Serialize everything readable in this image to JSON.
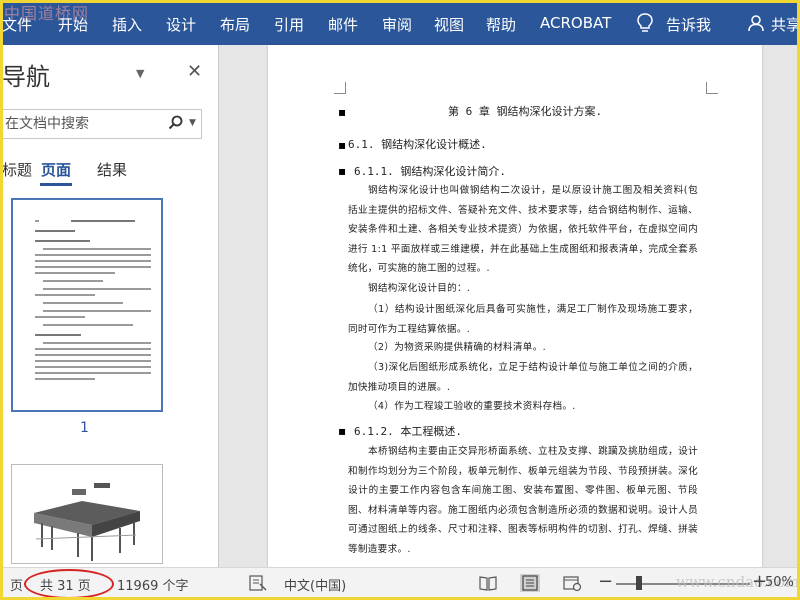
{
  "ribbon": {
    "watermark": "中国道桥网",
    "tabs": [
      "文件",
      "开始",
      "插入",
      "设计",
      "布局",
      "引用",
      "邮件",
      "审阅",
      "视图",
      "帮助",
      "ACROBAT",
      "告诉我",
      "共享"
    ],
    "bg_color": "#2b579a"
  },
  "nav": {
    "title": "导航",
    "search_placeholder": "在文档中搜索",
    "subtabs": [
      "标题",
      "页面",
      "结果"
    ],
    "active_subtab": "页面",
    "thumb_page_number": "1"
  },
  "doc": {
    "chapter": "第 6 章    钢结构深化设计方案.",
    "h2": "6.1.  钢结构深化设计概述.",
    "h3_1": "6.1.1.  钢结构深化设计简介.",
    "p1": "钢结构深化设计也叫做钢结构二次设计，是以原设计施工图及相关资料(包括业主提供的招标文件、答疑补充文件、技术要求等，结合钢结构制作、运输、安装条件和土建、各相关专业技术提资）为依据，依托软件平台，在虚拟空间内进行 1:1 平面放样或三维建模，并在此基础上生成图纸和报表清单，完成全套系统化，可实施的施工图的过程。.",
    "p2": "钢结构深化设计目的：.",
    "p3": "（1）结构设计图纸深化后具备可实施性，满足工厂制作及现场施工要求，同时可作为工程结算依据。.",
    "p4": "（2）为物资采购提供精确的材料清单。.",
    "p5": "（3)深化后图纸形成系统化，立足于结构设计单位与施工单位之间的介质，加快推动项目的进展。.",
    "p6": "（4）作为工程竣工验收的重要技术资料存档。.",
    "h3_2": "6.1.2.  本工程概述.",
    "p7": "本桥钢结构主要由正交异形桥面系统、立柱及支撑、跳躏及挑肋组成，设计和制作均划分为三个阶段，板单元制作、板单元组装为节段、节段预拼装。深化设计的主要工作内容包含车间施工图、安装布置图、零件图、板单元图、节段图、材料清单等内容。施工图纸内必须包含制造所必须的数据和说明。设计人员可通过图纸上的线条、尺寸和注释、图表等标明构件的切割、打孔、焊缝、拼装等制造要求。."
  },
  "status": {
    "page_prefix": "页",
    "page_count": "共 31 页",
    "word_count": "11969 个字",
    "language": "中文(中国)",
    "zoom": "50%",
    "watermark": "www.cndao.com"
  }
}
